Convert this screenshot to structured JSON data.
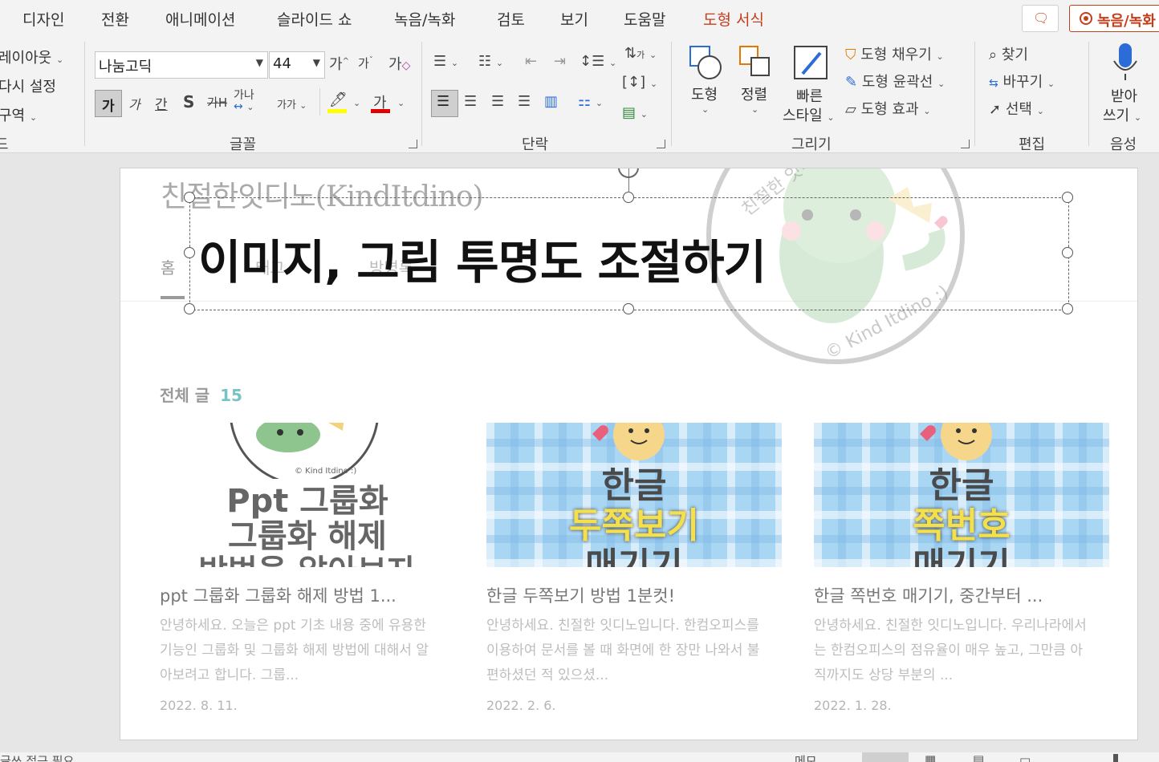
{
  "tabs": [
    "디자인",
    "전환",
    "애니메이션",
    "슬라이드 쇼",
    "녹음/녹화",
    "검토",
    "보기",
    "도움말",
    "도형 서식"
  ],
  "record_label": "녹음/녹화",
  "colors": {
    "accent": "#c43e1c",
    "highlight": "#ffff00",
    "font_color": "#e00000",
    "count_color": "#76c4c4"
  },
  "ribbon": {
    "slides_group": {
      "layout": "레이아웃",
      "reset": "다시 설정",
      "section": "구역",
      "group_label": "드"
    },
    "font_group": {
      "font_name": "나눔고딕",
      "font_size": "44",
      "grow": "가",
      "shrink": "가",
      "clear": "가",
      "bold": "가",
      "italic": "가",
      "underline": "간",
      "shadow": "S",
      "strike": "가",
      "spacing": "가나",
      "case": "가가",
      "font_color_char": "가",
      "label": "글꼴"
    },
    "paragraph_group": {
      "label": "단락"
    },
    "drawing_group": {
      "shapes": "도형",
      "arrange": "정렬",
      "quick_styles_1": "빠른",
      "quick_styles_2": "스타일",
      "fill": "도형 채우기",
      "outline": "도형 윤곽선",
      "effects": "도형 효과",
      "label": "그리기"
    },
    "editing_group": {
      "find": "찾기",
      "replace": "바꾸기",
      "select": "선택",
      "label": "편집"
    },
    "voice_group": {
      "dictate_1": "받아",
      "dictate_2": "쓰기",
      "label": "음성"
    }
  },
  "slide": {
    "blog_title": "친절한잇디노(KindItdino)",
    "nav": [
      "홈",
      "태그",
      "방명록"
    ],
    "textbox_text": "이미지, 그림 투명도 조절하기",
    "all_posts_label": "전체 글",
    "all_posts_count": "15",
    "watermark_top": "친절한 잇디노 :)",
    "watermark_bottom": "© Kind Itdino :)",
    "cards": [
      {
        "thumb_line1": "Ppt 그룹화",
        "thumb_line2": "그룹화 해제",
        "thumb_line3": "방법을 알아보자",
        "thumb_badge": "© Kind Itdino :)",
        "title": "ppt 그룹화 그룹화 해제 방법 1...",
        "excerpt": "안녕하세요. 오늘은 ppt 기초 내용 중에 유용한 기능인 그룹화 및 그룹화 해제 방법에 대해서 알아보려고 합니다. 그룹...",
        "date": "2022. 8. 11."
      },
      {
        "thumb_line1": "한글",
        "thumb_line2": "두쪽보기",
        "thumb_line3": "매기기",
        "title": "한글 두쪽보기 방법 1분컷!",
        "excerpt": "안녕하세요. 친절한 잇디노입니다. 한컴오피스를 이용하여 문서를 볼 때 화면에 한 장만 나와서 불편하셨던 적 있으셨...",
        "date": "2022. 2. 6."
      },
      {
        "thumb_line1": "한글",
        "thumb_line2": "쪽번호",
        "thumb_line3": "매기기",
        "title": "한글 쪽번호 매기기, 중간부터 ...",
        "excerpt": "안녕하세요. 친절한 잇디노입니다. 우리나라에서는 한컴오피스의 점유율이 매우 높고, 그만큼 아직까지도 상당 부분의 ...",
        "date": "2022. 1. 28."
      }
    ]
  },
  "statusbar": {
    "left": "글쓰 접근 필요",
    "notes": "메모"
  }
}
